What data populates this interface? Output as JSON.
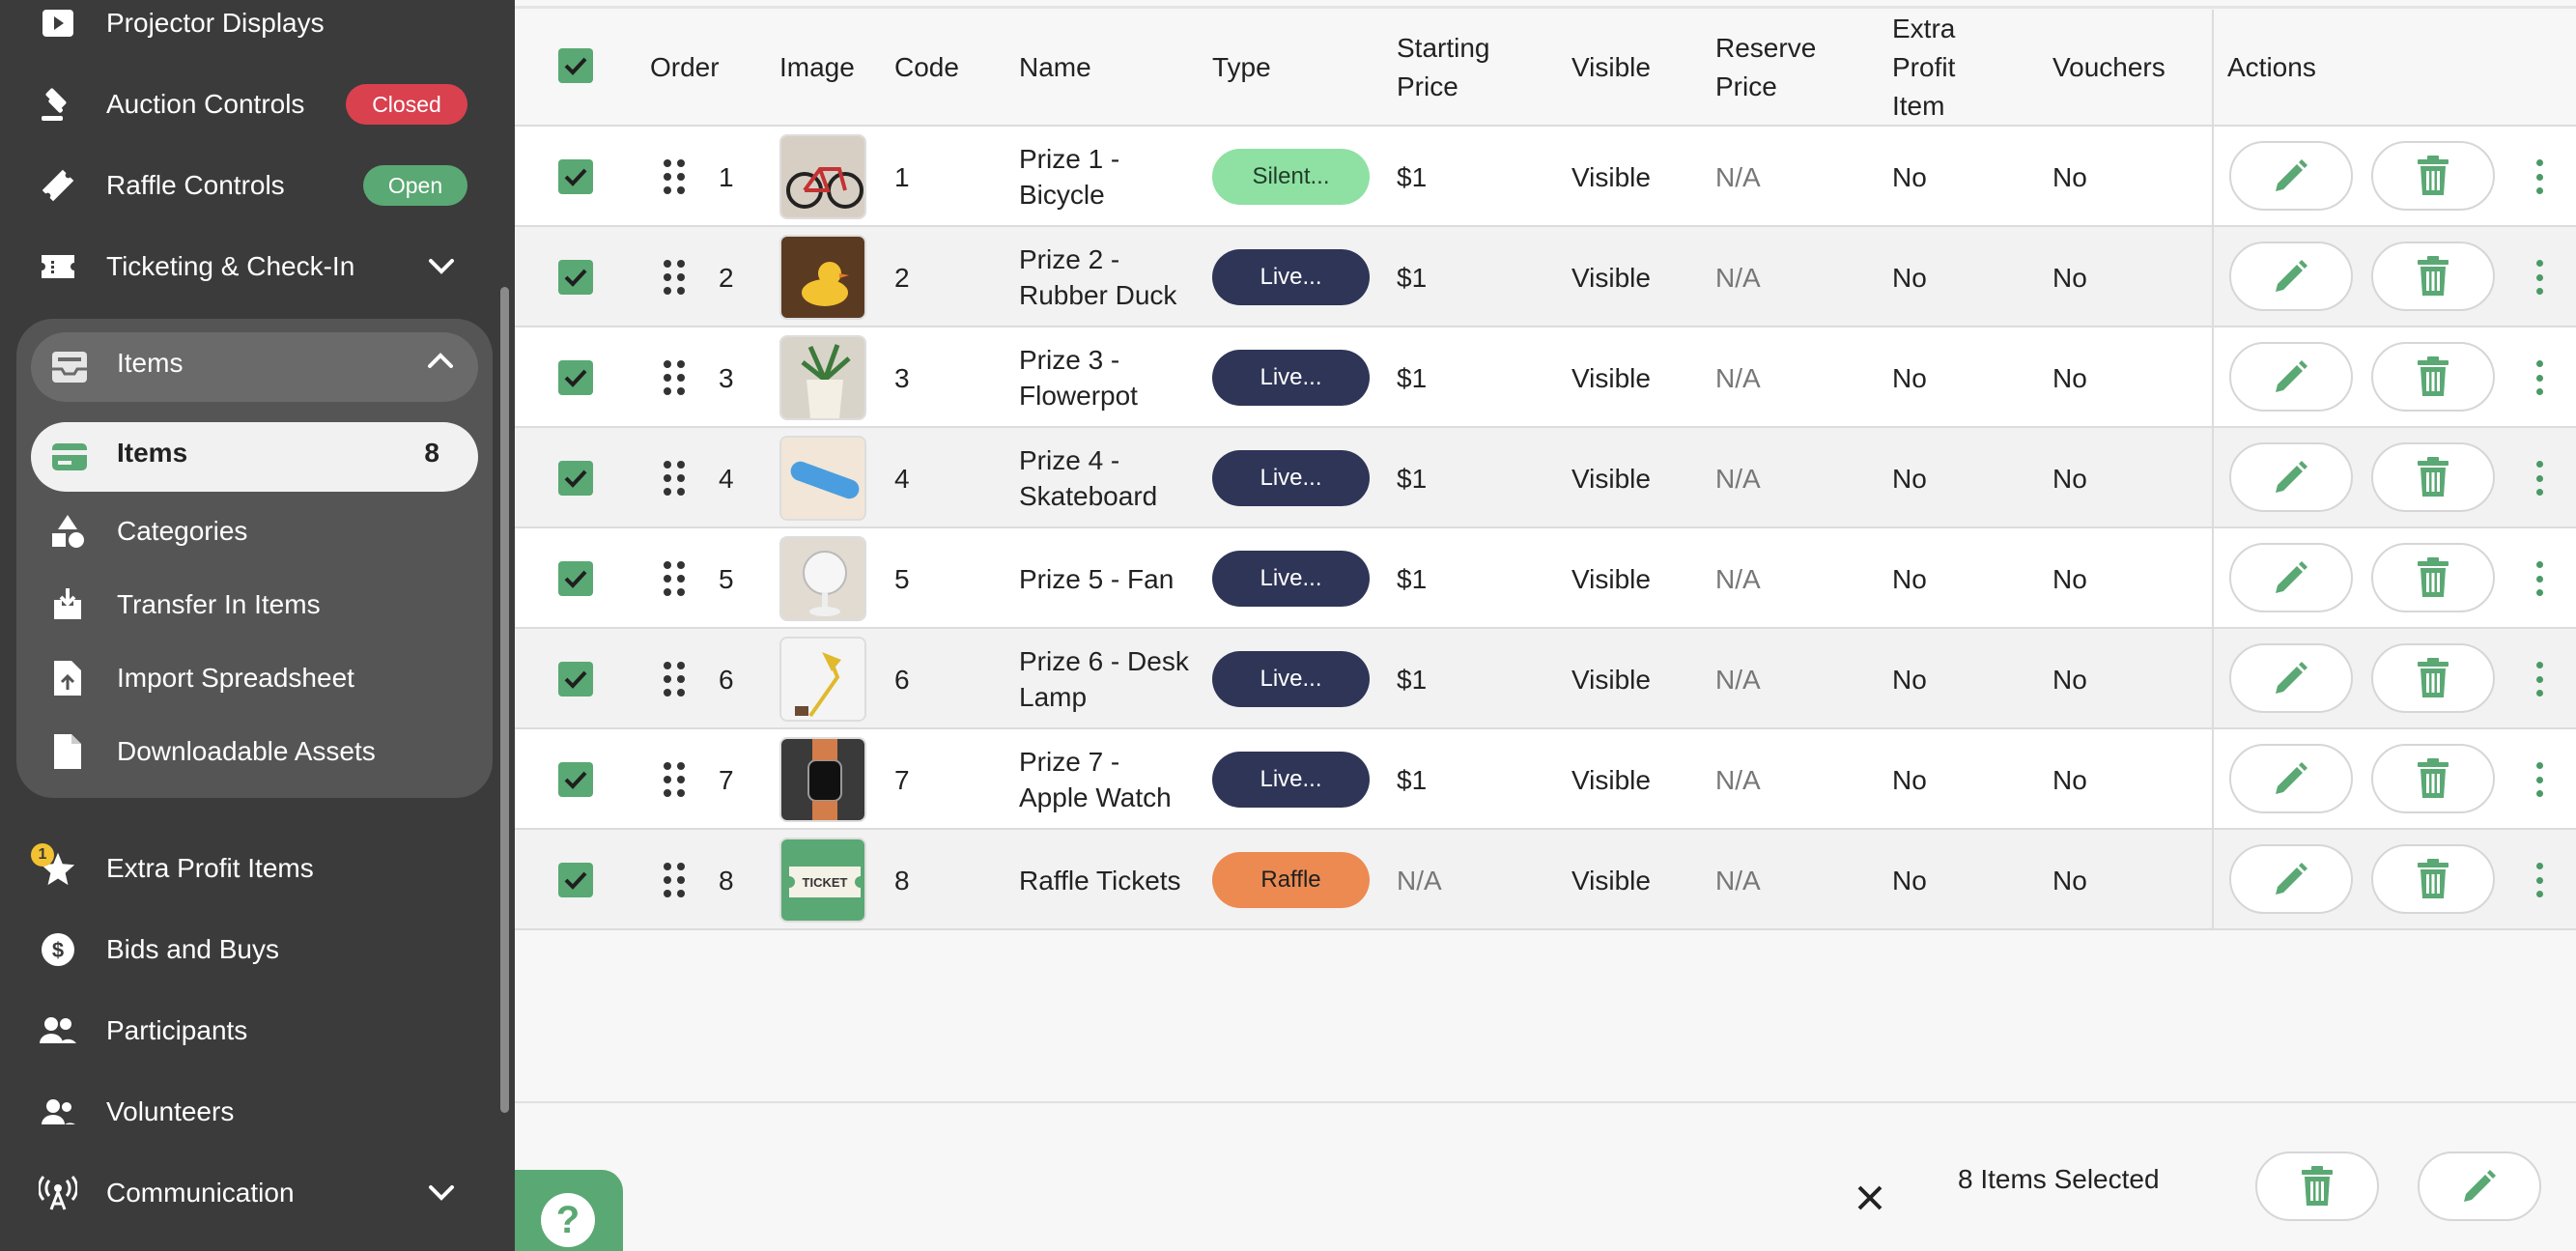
{
  "sidebar": {
    "projector_displays": "Projector Displays",
    "auction_controls": "Auction Controls",
    "auction_status": "Closed",
    "auction_status_color": "#d9414f",
    "raffle_controls": "Raffle Controls",
    "raffle_status": "Open",
    "raffle_status_color": "#5aa873",
    "ticketing": "Ticketing & Check-In",
    "items_group": {
      "header": "Items",
      "active_item": "Items",
      "active_count": "8",
      "sub_items": [
        "Categories",
        "Transfer In Items",
        "Import Spreadsheet",
        "Downloadable Assets"
      ]
    },
    "extra_profit_items": "Extra Profit Items",
    "extra_profit_badge": "1",
    "bids_and_buys": "Bids and Buys",
    "participants": "Participants",
    "volunteers": "Volunteers",
    "communication": "Communication"
  },
  "table": {
    "headers": {
      "order": "Order",
      "image": "Image",
      "code": "Code",
      "name": "Name",
      "type": "Type",
      "starting_price_1": "Starting",
      "starting_price_2": "Price",
      "visible": "Visible",
      "reserve_price_1": "Reserve",
      "reserve_price_2": "Price",
      "extra_profit_1": "Extra",
      "extra_profit_2": "Profit",
      "extra_profit_3": "Item",
      "vouchers": "Vouchers",
      "actions": "Actions"
    },
    "rows": [
      {
        "order": "1",
        "code": "1",
        "name_1": "Prize 1 -",
        "name_2": "Bicycle",
        "type": "Silent...",
        "type_kind": "silent",
        "price": "$1",
        "visible": "Visible",
        "reserve": "N/A",
        "extra": "No",
        "vouchers": "No",
        "image": "bicycle"
      },
      {
        "order": "2",
        "code": "2",
        "name_1": "Prize 2 -",
        "name_2": "Rubber Duck",
        "type": "Live...",
        "type_kind": "live",
        "price": "$1",
        "visible": "Visible",
        "reserve": "N/A",
        "extra": "No",
        "vouchers": "No",
        "image": "duck"
      },
      {
        "order": "3",
        "code": "3",
        "name_1": "Prize 3 -",
        "name_2": "Flowerpot",
        "type": "Live...",
        "type_kind": "live",
        "price": "$1",
        "visible": "Visible",
        "reserve": "N/A",
        "extra": "No",
        "vouchers": "No",
        "image": "flowerpot"
      },
      {
        "order": "4",
        "code": "4",
        "name_1": "Prize 4 -",
        "name_2": "Skateboard",
        "type": "Live...",
        "type_kind": "live",
        "price": "$1",
        "visible": "Visible",
        "reserve": "N/A",
        "extra": "No",
        "vouchers": "No",
        "image": "skateboard"
      },
      {
        "order": "5",
        "code": "5",
        "name_1": "Prize 5 - Fan",
        "name_2": "",
        "type": "Live...",
        "type_kind": "live",
        "price": "$1",
        "visible": "Visible",
        "reserve": "N/A",
        "extra": "No",
        "vouchers": "No",
        "image": "fan"
      },
      {
        "order": "6",
        "code": "6",
        "name_1": "Prize 6 - Desk",
        "name_2": "Lamp",
        "type": "Live...",
        "type_kind": "live",
        "price": "$1",
        "visible": "Visible",
        "reserve": "N/A",
        "extra": "No",
        "vouchers": "No",
        "image": "lamp"
      },
      {
        "order": "7",
        "code": "7",
        "name_1": "Prize 7 -",
        "name_2": "Apple Watch",
        "type": "Live...",
        "type_kind": "live",
        "price": "$1",
        "visible": "Visible",
        "reserve": "N/A",
        "extra": "No",
        "vouchers": "No",
        "image": "watch"
      },
      {
        "order": "8",
        "code": "8",
        "name_1": "Raffle Tickets",
        "name_2": "",
        "type": "Raffle",
        "type_kind": "raffle",
        "price": "N/A",
        "visible": "Visible",
        "reserve": "N/A",
        "extra": "No",
        "vouchers": "No",
        "image": "ticket"
      }
    ]
  },
  "raffle_ticket_label": "TICKET",
  "bottom_bar": {
    "selected_text": "8 Items Selected",
    "help_label": "?"
  },
  "colors": {
    "accent_green": "#5aa873",
    "live_pill": "#2e3557",
    "silent_pill": "#8fe0a3",
    "raffle_pill": "#ec8a52",
    "sidebar_bg": "#3b3b3b"
  }
}
